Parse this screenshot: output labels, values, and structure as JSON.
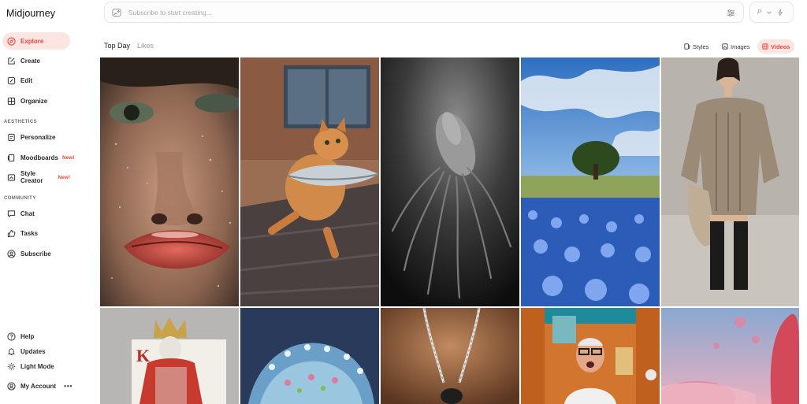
{
  "app": {
    "name": "Midjourney"
  },
  "sidebar": {
    "items": [
      {
        "label": "Explore",
        "icon": "compass-icon",
        "active": true
      },
      {
        "label": "Create",
        "icon": "pencil-icon"
      },
      {
        "label": "Edit",
        "icon": "edit-icon"
      },
      {
        "label": "Organize",
        "icon": "grid-icon"
      }
    ],
    "aesthetics_label": "AESTHETICS",
    "aesthetics_items": [
      {
        "label": "Personalize",
        "icon": "personalize-icon"
      },
      {
        "label": "Moodboards",
        "icon": "moodboard-icon",
        "badge": "New!"
      },
      {
        "label": "Style Creator",
        "icon": "style-creator-icon",
        "badge": "New!"
      }
    ],
    "community_label": "COMMUNITY",
    "community_items": [
      {
        "label": "Chat",
        "icon": "chat-icon"
      },
      {
        "label": "Tasks",
        "icon": "thumbs-up-icon"
      },
      {
        "label": "Subscribe",
        "icon": "user-circle-icon"
      }
    ],
    "footer_items": [
      {
        "label": "Help",
        "icon": "help-icon"
      },
      {
        "label": "Updates",
        "icon": "bell-icon"
      },
      {
        "label": "Light Mode",
        "icon": "sun-icon"
      },
      {
        "label": "My Account",
        "icon": "account-icon",
        "more": "•••"
      }
    ]
  },
  "prompt": {
    "placeholder": "Subscribe to start creating..."
  },
  "mode": {
    "label": "P"
  },
  "tabs": [
    {
      "label": "Top Day",
      "active": true
    },
    {
      "label": "Likes"
    }
  ],
  "filters": [
    {
      "label": "Styles"
    },
    {
      "label": "Images"
    },
    {
      "label": "Videos",
      "active": true
    }
  ],
  "colors": {
    "accent": "#e5483a",
    "accent_bg": "#fde5e2"
  },
  "gallery": [
    {
      "subject": "close-up glossy face with red lips"
    },
    {
      "subject": "cat running holding a fish"
    },
    {
      "subject": "black and white squid"
    },
    {
      "subject": "tree in blue flower field"
    },
    {
      "subject": "woman in knit sweater dress with boots"
    },
    {
      "subject": "king of hearts playing card figure"
    },
    {
      "subject": "jeweled crystal object"
    },
    {
      "subject": "silver chain necklace"
    },
    {
      "subject": "surprised old man in orange room"
    },
    {
      "subject": "pink surreal landscape"
    }
  ]
}
